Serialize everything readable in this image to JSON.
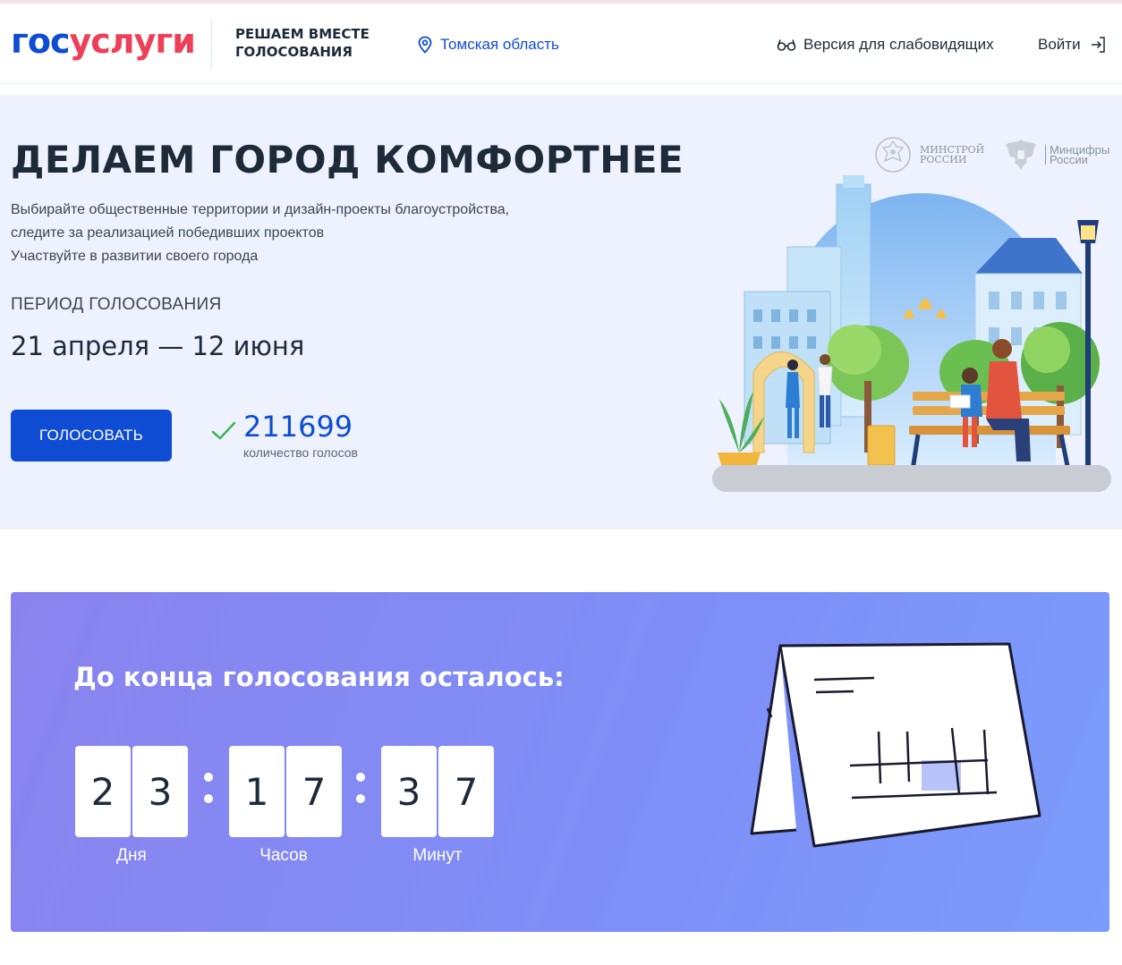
{
  "header": {
    "logo_part1": "гос",
    "logo_part2": "услуги",
    "tagline": "РЕШАЕМ ВМЕСТЕ ГОЛОСОВАНИЯ",
    "region": "Томская область",
    "accessibility": "Версия для слабовидящих",
    "login": "Войти"
  },
  "hero": {
    "title": "ДЕЛАЕМ ГОРОД КОМФОРТНЕЕ",
    "description": [
      "Выбирайте общественные территории и дизайн-проекты благоустройства,",
      "следите за реализацией победивших проектов",
      "Участвуйте в развитии своего города"
    ],
    "period_label": "ПЕРИОД ГОЛОСОВАНИЯ",
    "period_value": "21 апреля — 12 июня",
    "vote_button": "ГОЛОСОВАТЬ",
    "votes_count": "211699",
    "votes_label": "количество голосов",
    "ministry1": [
      "МИНСТРОЙ",
      "РОССИИ"
    ],
    "ministry2": [
      "Минцифры",
      "России"
    ]
  },
  "countdown": {
    "title": "До конца голосования осталось:",
    "days": [
      "2",
      "3"
    ],
    "hours": [
      "1",
      "7"
    ],
    "minutes": [
      "3",
      "7"
    ],
    "days_label": "Дня",
    "hours_label": "Часов",
    "minutes_label": "Минут"
  },
  "colors": {
    "brand_blue": "#0d4cd3",
    "brand_red": "#ee3f58",
    "hero_bg": "#edf2fe",
    "countdown_bg": "#8089f3",
    "check_green": "#3fb351"
  },
  "icons": [
    "location-pin-icon",
    "glasses-icon",
    "login-arrow-icon",
    "checkmark-icon",
    "emblem-icon",
    "calendar-illustration"
  ]
}
